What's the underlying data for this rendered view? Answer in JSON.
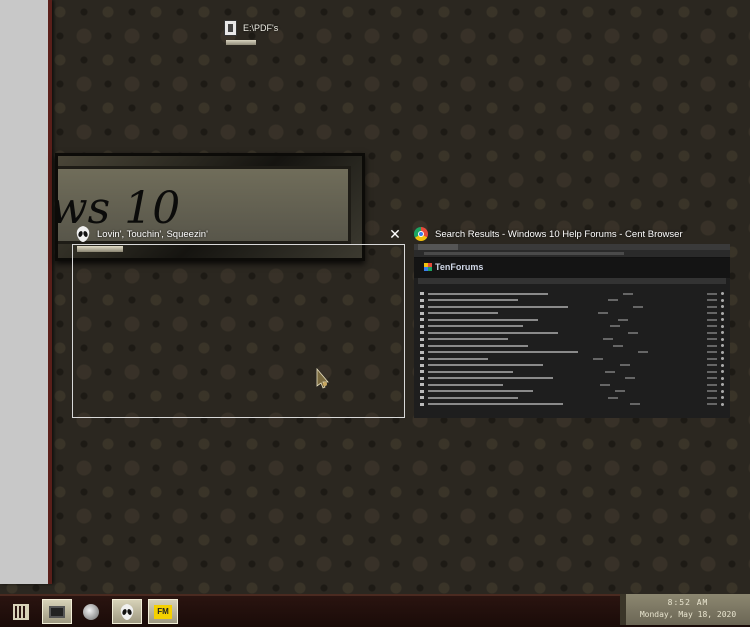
{
  "desktop": {
    "icon_label": "E:\\PDF's"
  },
  "banner": {
    "text": "ws 10"
  },
  "task_view": {
    "window1_title": "Lovin', Touchin', Squeezin'",
    "window2_title": "Search Results - Windows 10 Help Forums - Cent Browser",
    "close_label": "✕",
    "browser_logo_text": "TenForums"
  },
  "taskbar": {
    "fm_label": "FM"
  },
  "clock": {
    "time": "8:52 AM",
    "date": "Monday, May 18, 2020"
  }
}
